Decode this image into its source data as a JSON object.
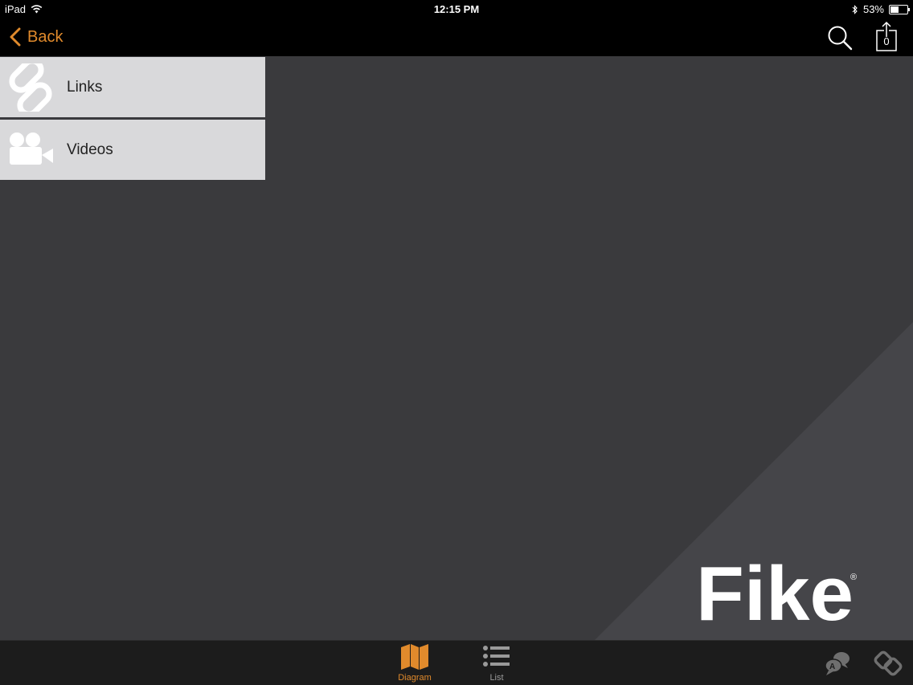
{
  "status_bar": {
    "device": "iPad",
    "time": "12:15 PM",
    "battery": "53%",
    "battery_level": 0.53
  },
  "nav": {
    "back_label": "Back",
    "share_count": "0"
  },
  "menu": {
    "items": [
      {
        "label": "Links",
        "icon": "link-icon"
      },
      {
        "label": "Videos",
        "icon": "video-camera-icon"
      }
    ]
  },
  "logo": {
    "text": "Fike",
    "registered_mark": "®"
  },
  "tab_bar": {
    "tabs": [
      {
        "label": "Diagram",
        "icon": "map-icon",
        "active": true
      },
      {
        "label": "List",
        "icon": "list-icon",
        "active": false
      }
    ],
    "right_icons": [
      "translate-icon",
      "chain-icon"
    ]
  },
  "colors": {
    "accent": "#e08a2c",
    "bars": "#000000",
    "background": "#3a3a3d",
    "menu_item": "#d9d9db"
  }
}
